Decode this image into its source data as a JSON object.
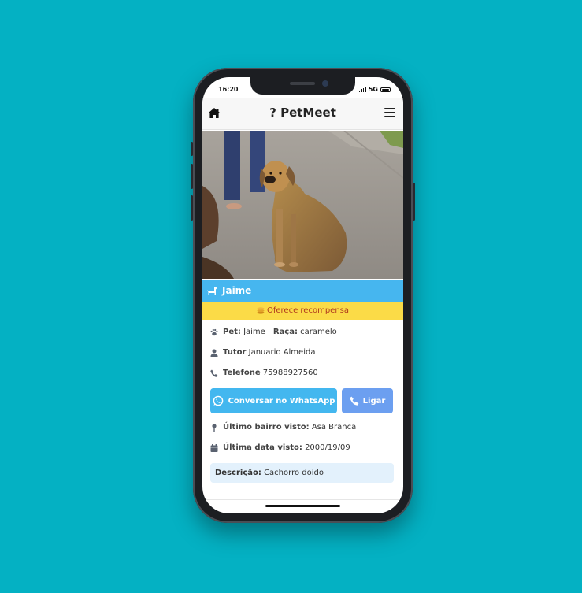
{
  "status_bar": {
    "time": "16:20",
    "network": "5G"
  },
  "navbar": {
    "brand": "PetMeet",
    "home_icon": "home-icon",
    "menu_icon": "menu-icon"
  },
  "pet": {
    "name": "Jaime",
    "reward": "Oferece recompensa",
    "pet_label": "Pet:",
    "pet_name": "Jaime",
    "breed_label": "Raça:",
    "breed": "caramelo",
    "tutor_label": "Tutor",
    "tutor": "Januario Almeida",
    "phone_label": "Telefone",
    "phone": "75988927560",
    "neighborhood_label": "Último bairro visto:",
    "neighborhood": "Asa Branca",
    "date_label": "Última data visto:",
    "date": "2000/19/09",
    "description_label": "Descrição:",
    "description": "Cachorro doido"
  },
  "buttons": {
    "whatsapp": "Conversar no WhatsApp",
    "call": "Ligar"
  },
  "colors": {
    "background": "#04b1c3",
    "name_bar": "#46b6ef",
    "reward_bar": "#fbdb47",
    "whatsapp_button": "#43b7ef",
    "call_button": "#6c9ff0",
    "description_box": "#e3f1fc"
  }
}
